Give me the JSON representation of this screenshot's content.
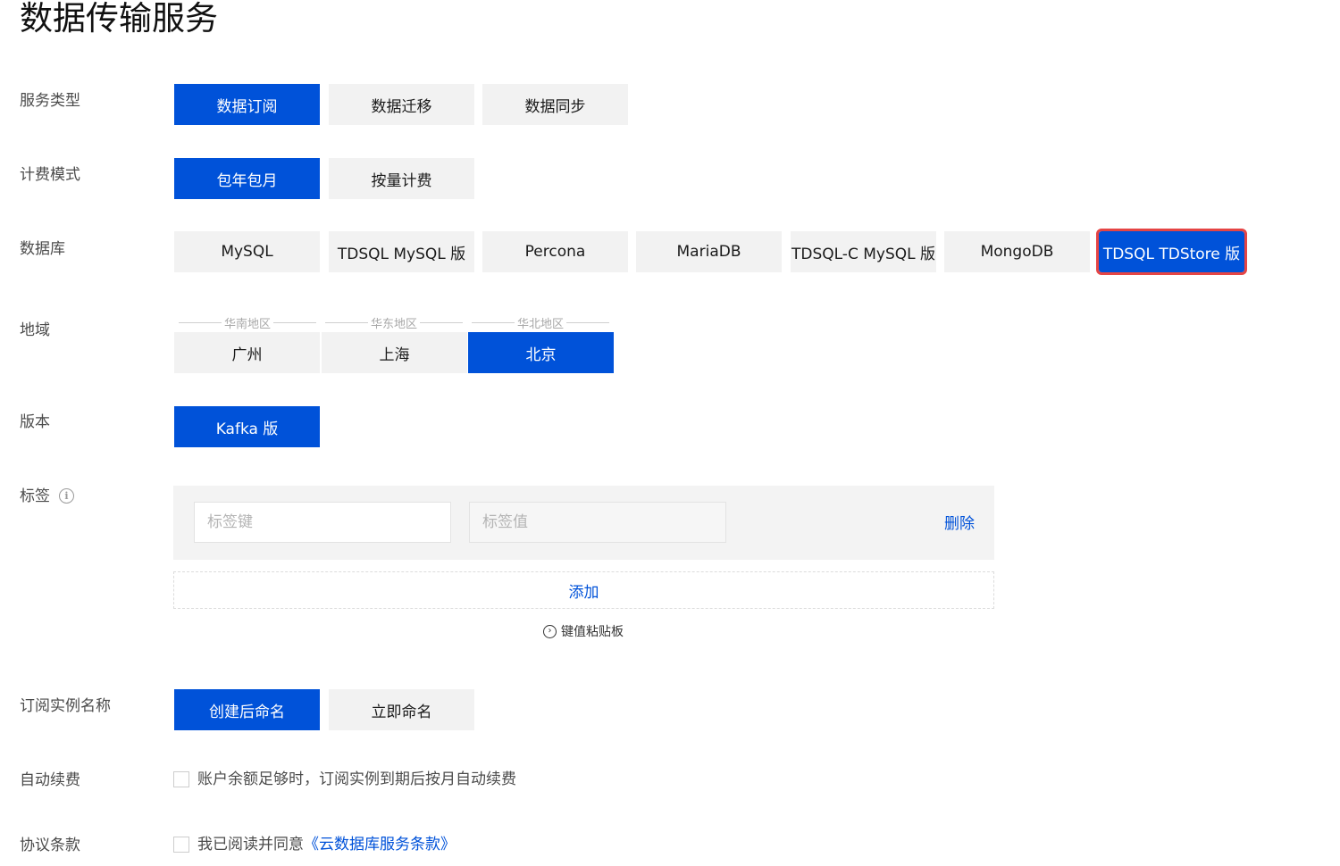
{
  "title": "数据传输服务",
  "labels": {
    "service_type": "服务类型",
    "billing_mode": "计费模式",
    "database": "数据库",
    "region": "地域",
    "version": "版本",
    "tags": "标签",
    "instance_name": "订阅实例名称",
    "auto_renew": "自动续费",
    "agreement": "协议条款"
  },
  "service_type": {
    "options": [
      "数据订阅",
      "数据迁移",
      "数据同步"
    ],
    "selected": "数据订阅"
  },
  "billing_mode": {
    "options": [
      "包年包月",
      "按量计费"
    ],
    "selected": "包年包月"
  },
  "database": {
    "options": [
      "MySQL",
      "TDSQL MySQL 版",
      "Percona",
      "MariaDB",
      "TDSQL-C MySQL 版",
      "MongoDB",
      "TDSQL TDStore 版"
    ],
    "selected": "TDSQL TDStore 版"
  },
  "region": {
    "groups": [
      {
        "name": "华南地区",
        "city": "广州"
      },
      {
        "name": "华东地区",
        "city": "上海"
      },
      {
        "name": "华北地区",
        "city": "北京"
      }
    ],
    "selected": "北京"
  },
  "version": {
    "options": [
      "Kafka 版"
    ],
    "selected": "Kafka 版"
  },
  "tags": {
    "info_icon": "info-icon",
    "key_placeholder": "标签键",
    "value_placeholder": "标签值",
    "delete_label": "删除",
    "add_label": "添加",
    "paste_label": "键值粘贴板"
  },
  "instance_name": {
    "options": [
      "创建后命名",
      "立即命名"
    ],
    "selected": "创建后命名"
  },
  "auto_renew": {
    "text": "账户余额足够时，订阅实例到期后按月自动续费"
  },
  "agreement": {
    "prefix": "我已阅读并同意",
    "link": "《云数据库服务条款》"
  },
  "colors": {
    "primary": "#0052d9",
    "highlight": "#e54545",
    "inactive_bg": "#f2f2f2"
  }
}
